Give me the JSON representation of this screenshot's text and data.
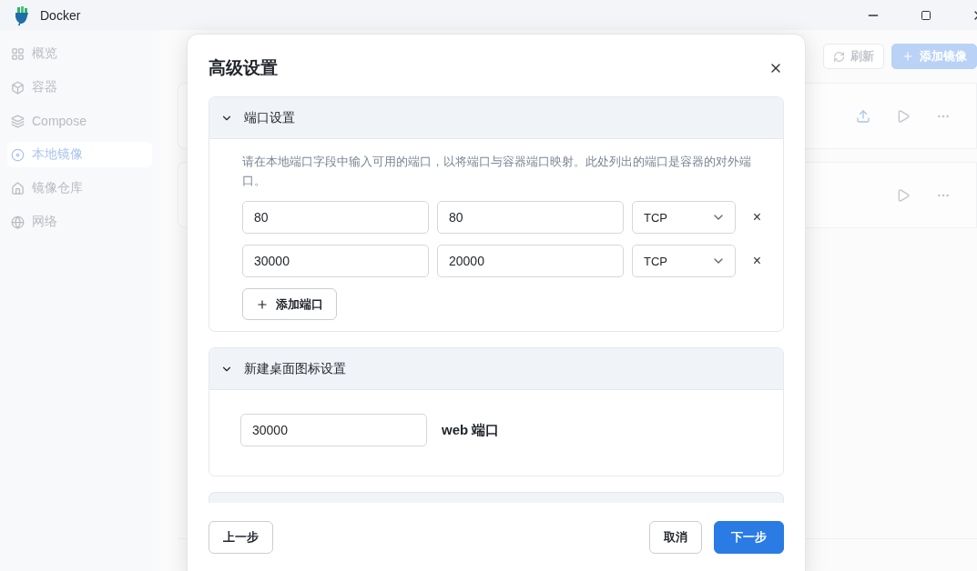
{
  "window": {
    "title": "Docker"
  },
  "sidebar": {
    "items": [
      {
        "label": "概览",
        "selected": false
      },
      {
        "label": "容器",
        "selected": false
      },
      {
        "label": "Compose",
        "selected": false
      },
      {
        "label": "本地镜像",
        "selected": true
      },
      {
        "label": "镜像仓库",
        "selected": false
      },
      {
        "label": "网络",
        "selected": false
      }
    ]
  },
  "main": {
    "toolbar": [
      {
        "label": "刷新",
        "kind": "refresh"
      },
      {
        "label": "添加镜像",
        "kind": "add"
      }
    ],
    "cards": [
      {
        "actions": [
          {
            "kind": "upload"
          },
          {
            "kind": "run"
          },
          {
            "kind": "more"
          }
        ]
      },
      {
        "actions": [
          {
            "kind": "run"
          },
          {
            "kind": "more"
          }
        ]
      }
    ]
  },
  "dialog": {
    "title": "高级设置",
    "sections": [
      {
        "kind": "ports",
        "title": "端口设置",
        "expanded": true,
        "description": "请在本地端口字段中输入可用的端口，以将端口与容器端口映射。此处列出的端口是容器的对外端口。",
        "ports": [
          {
            "local": "80",
            "container": "80",
            "protocol": "TCP",
            "remove": "×"
          },
          {
            "local": "30000",
            "container": "20000",
            "protocol": "TCP",
            "remove": "×"
          }
        ],
        "add_button": "添加端口"
      },
      {
        "kind": "web",
        "title": "新建桌面图标设置",
        "expanded": true,
        "port": "30000",
        "label": "web 端口"
      },
      {
        "kind": "partial"
      }
    ],
    "buttons": [
      {
        "label": "上一步",
        "kind": "back"
      },
      {
        "label": "取消",
        "kind": "cancel"
      },
      {
        "label": "下一步",
        "kind": "primary"
      }
    ]
  }
}
